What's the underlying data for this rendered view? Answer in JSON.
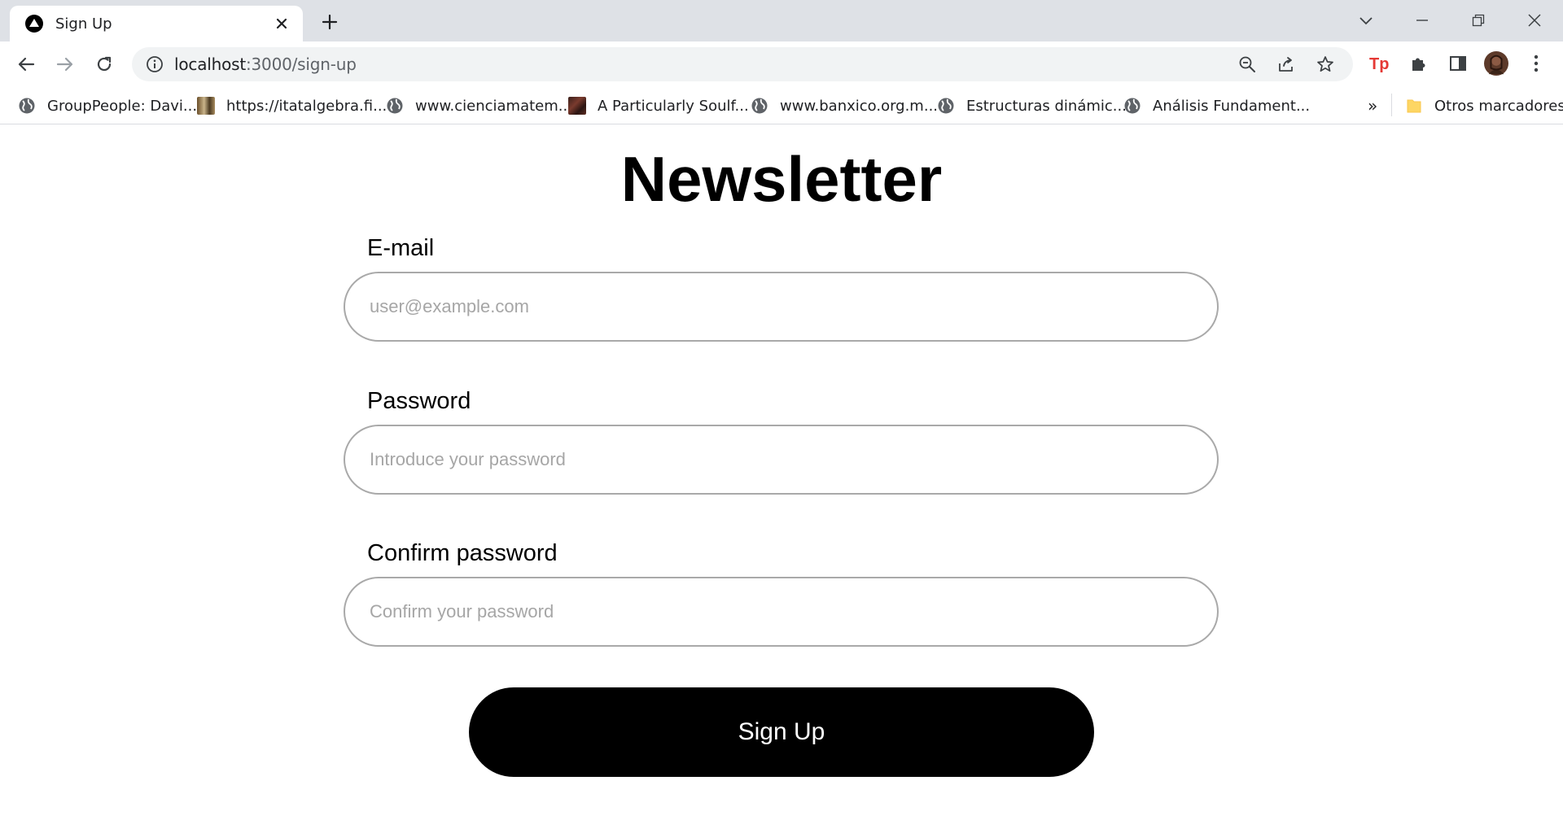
{
  "browser": {
    "tab_title": "Sign Up",
    "url_host": "localhost",
    "url_path": ":3000/sign-up",
    "bookmarks": [
      {
        "label": "GroupPeople: Davi...",
        "icon": "globe-icon"
      },
      {
        "label": "https://itatalgebra.fi...",
        "icon": "thumbnail"
      },
      {
        "label": "www.cienciamatem...",
        "icon": "globe-icon"
      },
      {
        "label": "A Particularly Soulf...",
        "icon": "thumbnail"
      },
      {
        "label": "www.banxico.org.m...",
        "icon": "globe-icon"
      },
      {
        "label": "Estructuras dinámic...",
        "icon": "globe-icon"
      },
      {
        "label": "Análisis Fundament...",
        "icon": "globe-icon"
      }
    ],
    "more_bookmarks": "»",
    "other_bookmarks": "Otros marcadores"
  },
  "form": {
    "title": "Newsletter",
    "email": {
      "label": "E-mail",
      "placeholder": "user@example.com"
    },
    "password": {
      "label": "Password",
      "placeholder": "Introduce your password"
    },
    "confirm": {
      "label": "Confirm password",
      "placeholder": "Confirm your password"
    },
    "submit_label": "Sign Up"
  },
  "colors": {
    "tabstrip": "#dee1e6",
    "omnibox": "#f1f3f4",
    "button_bg": "#000000",
    "field_border": "#a9a9a9",
    "placeholder": "#a6a6a6"
  }
}
